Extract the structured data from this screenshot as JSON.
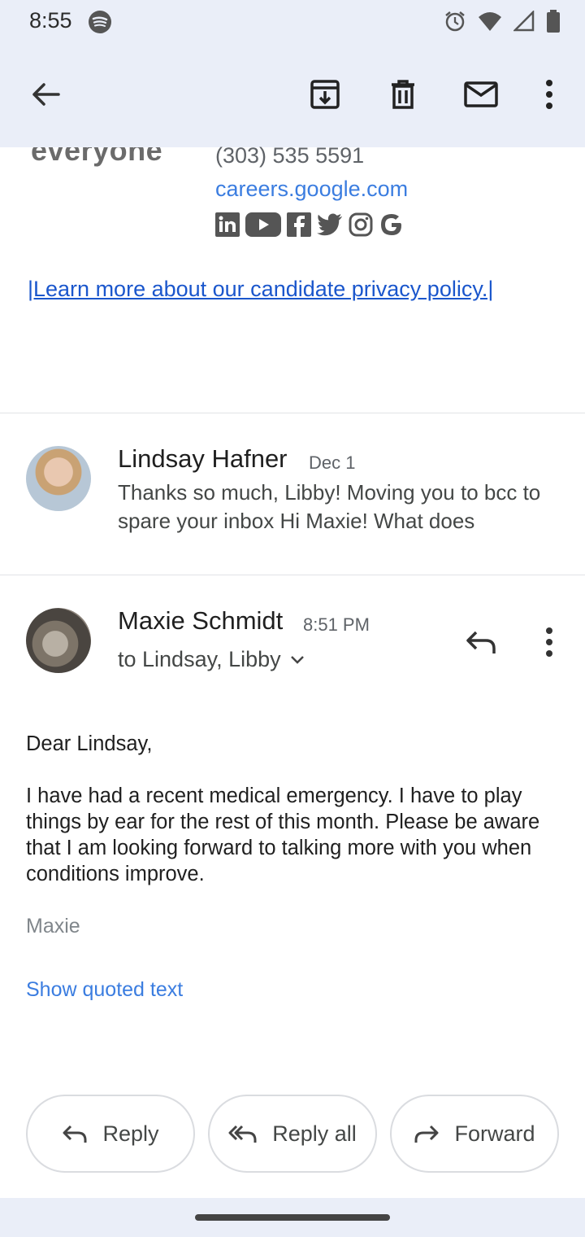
{
  "status_bar": {
    "time": "8:55",
    "icons": [
      "spotify-icon",
      "alarm-icon",
      "wifi-icon",
      "signal-icon",
      "battery-icon"
    ]
  },
  "toolbar": {
    "icons": [
      "back-arrow-icon",
      "archive-icon",
      "delete-icon",
      "mark-unread-icon",
      "more-vert-icon"
    ]
  },
  "signature": {
    "logo_text": "everyone",
    "phone": "(303) 535 5591",
    "website": "careers.google.com",
    "social_icons": [
      "linkedin-icon",
      "youtube-icon",
      "facebook-icon",
      "twitter-icon",
      "instagram-icon",
      "google-icon"
    ],
    "privacy_link": "|Learn more about our candidate privacy policy.|"
  },
  "collapsed_message": {
    "sender": "Lindsay Hafner",
    "date": "Dec 1",
    "snippet": "Thanks so much, Libby! Moving you to bcc to spare your inbox Hi Maxie! What does"
  },
  "expanded_message": {
    "sender": "Maxie Schmidt",
    "time": "8:51 PM",
    "recipients": "to Lindsay, Libby",
    "greeting": "Dear Lindsay,",
    "body": "I have had a recent medical emergency. I have to play things by ear for the rest of this month. Please be aware that I am looking forward to talking more with you when conditions improve.",
    "signoff": "Maxie",
    "show_quoted": "Show quoted text"
  },
  "actions": {
    "reply": "Reply",
    "reply_all": "Reply all",
    "forward": "Forward"
  },
  "colors": {
    "header_bg": "#eaeef8",
    "link": "#3b7de0",
    "privacy_link": "#1a56cc"
  }
}
